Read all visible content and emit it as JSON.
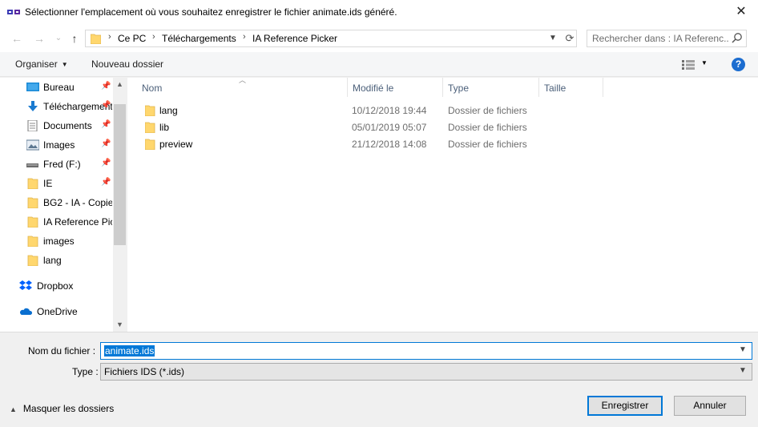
{
  "window": {
    "title": "Sélectionner l'emplacement où vous souhaitez enregistrer le fichier animate.ids généré.",
    "close_glyph": "✕"
  },
  "nav_buttons": {
    "back": "←",
    "forward": "→",
    "recent": "⌄",
    "up": "↑"
  },
  "breadcrumb": {
    "items": [
      "Ce PC",
      "Téléchargements",
      "IA Reference Picker"
    ],
    "separator": "›"
  },
  "search": {
    "placeholder": "Rechercher dans : IA Referenc..."
  },
  "toolbar": {
    "organize_label": "Organiser",
    "new_folder_label": "Nouveau dossier",
    "help_label": "?"
  },
  "navpane": {
    "items": [
      {
        "label": "Bureau",
        "icon": "desktop-icon",
        "pinned": true
      },
      {
        "label": "Téléchargements",
        "icon": "download-icon",
        "pinned": true
      },
      {
        "label": "Documents",
        "icon": "documents-icon",
        "pinned": true
      },
      {
        "label": "Images",
        "icon": "pictures-icon",
        "pinned": true
      },
      {
        "label": "Fred (F:)",
        "icon": "drive-icon",
        "pinned": true
      },
      {
        "label": "IE",
        "icon": "folder-icon",
        "pinned": true
      },
      {
        "label": "BG2 - IA - Copie",
        "icon": "folder-icon",
        "pinned": false
      },
      {
        "label": "IA Reference Picker",
        "icon": "folder-icon",
        "pinned": false
      },
      {
        "label": "images",
        "icon": "folder-icon",
        "pinned": false
      },
      {
        "label": "lang",
        "icon": "folder-icon",
        "pinned": false
      },
      {
        "label": "Dropbox",
        "icon": "dropbox-icon",
        "pinned": false
      },
      {
        "label": "OneDrive",
        "icon": "onedrive-icon",
        "pinned": false
      }
    ]
  },
  "filelist": {
    "columns": [
      "Nom",
      "Modifié le",
      "Type",
      "Taille"
    ],
    "rows": [
      {
        "name": "lang",
        "modified": "10/12/2018 19:44",
        "type": "Dossier de fichiers"
      },
      {
        "name": "lib",
        "modified": "05/01/2019 05:07",
        "type": "Dossier de fichiers"
      },
      {
        "name": "preview",
        "modified": "21/12/2018 14:08",
        "type": "Dossier de fichiers"
      }
    ]
  },
  "form": {
    "filename_label": "Nom du fichier :",
    "filename_value": "animate.ids",
    "filetype_label": "Type :",
    "filetype_value": "Fichiers IDS (*.ids)"
  },
  "footer": {
    "hide_folders_label": "Masquer les dossiers",
    "save_label": "Enregistrer",
    "cancel_label": "Annuler"
  },
  "colors": {
    "accent": "#0078d7",
    "folder": "#ffd76e",
    "header_text": "#4c607a"
  }
}
